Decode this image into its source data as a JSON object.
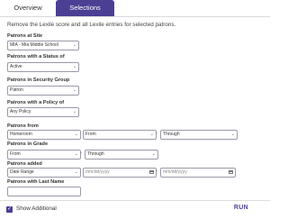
{
  "tabs": {
    "overview": "Overview",
    "selections": "Selections"
  },
  "description": "Remove the Lexile score and all Lexile entries for selected patrons.",
  "fields": {
    "site_label": "Patrons at Site",
    "site_value": "MIA - Mia Middle School",
    "status_label": "Patrons with a Status of",
    "status_value": "Active",
    "group_label": "Patrons in Security Group",
    "group_value": "Patron",
    "policy_label": "Patrons with a Policy of",
    "policy_value": "Any Policy",
    "from_label": "Patrons from",
    "from_value": "Homeroom",
    "from_from": "From",
    "from_through": "Through",
    "grade_label": "Patrons in Grade",
    "grade_from": "From",
    "grade_through": "Through",
    "added_label": "Patrons added",
    "added_value": "Date Range",
    "added_start_placeholder": "mm/dd/yyyy",
    "added_end_placeholder": "mm/dd/yyyy",
    "lastname_label": "Patrons with Last Name",
    "dash": "-"
  },
  "footer": {
    "show_additional": "Show Additional",
    "run": "RUN",
    "checked": true
  },
  "colors": {
    "accent": "#4a3f93"
  }
}
